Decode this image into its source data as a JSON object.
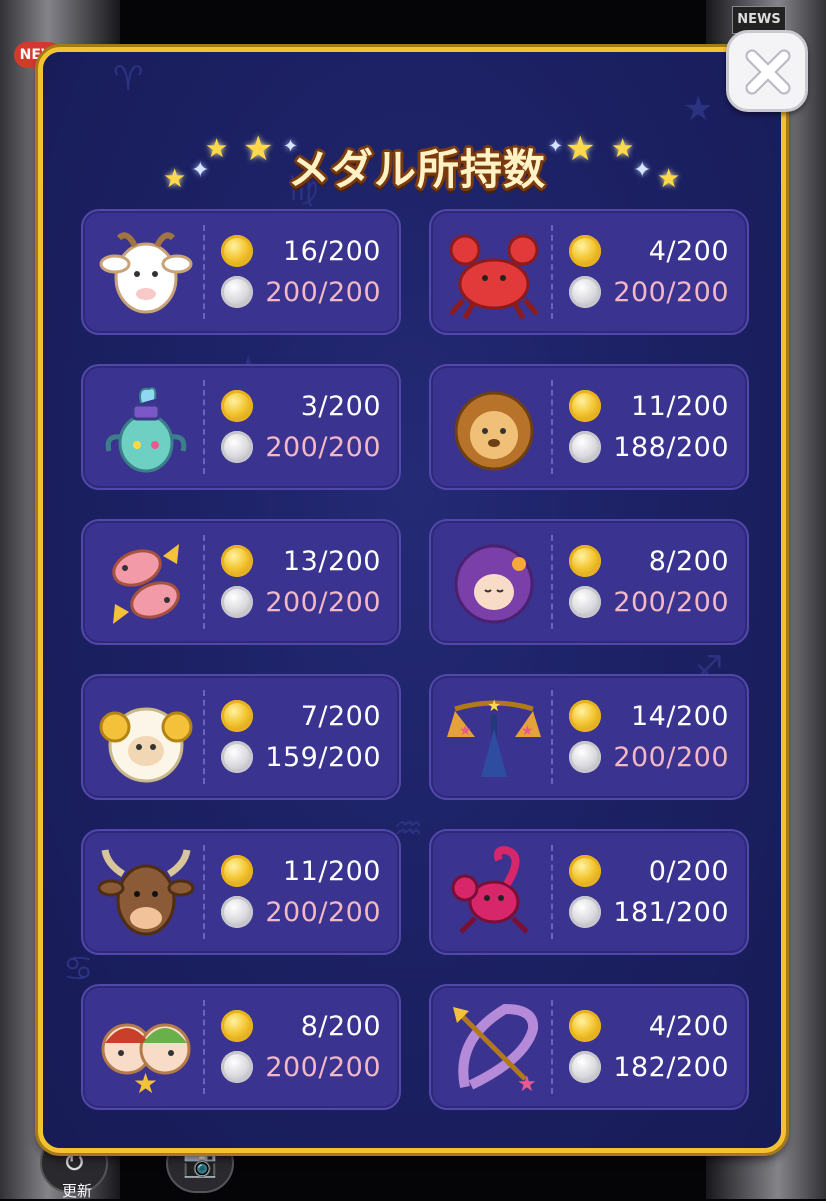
{
  "background": {
    "news_badge_left": "NEW",
    "news_badge_right": "NEWS",
    "bottom_label": "更新"
  },
  "panel": {
    "title": "メダル所持数",
    "close_icon": "close-icon",
    "colors": {
      "panel": "#1b2062",
      "border": "#f2c231",
      "card": "#3a338f",
      "full_count": "#f3b8c6"
    }
  },
  "medals": [
    {
      "sign": "aries-goat-icon",
      "gold": "16/200",
      "silver": "200/200",
      "silver_full": true
    },
    {
      "sign": "cancer-crab-icon",
      "gold": "4/200",
      "silver": "200/200",
      "silver_full": true
    },
    {
      "sign": "aquarius-vase-icon",
      "gold": "3/200",
      "silver": "200/200",
      "silver_full": true
    },
    {
      "sign": "leo-lion-icon",
      "gold": "11/200",
      "silver": "188/200",
      "silver_full": false
    },
    {
      "sign": "pisces-fish-icon",
      "gold": "13/200",
      "silver": "200/200",
      "silver_full": true
    },
    {
      "sign": "virgo-maiden-icon",
      "gold": "8/200",
      "silver": "200/200",
      "silver_full": true
    },
    {
      "sign": "aries-ram-icon",
      "gold": "7/200",
      "silver": "159/200",
      "silver_full": false
    },
    {
      "sign": "libra-scales-icon",
      "gold": "14/200",
      "silver": "200/200",
      "silver_full": true
    },
    {
      "sign": "taurus-bull-icon",
      "gold": "11/200",
      "silver": "200/200",
      "silver_full": true
    },
    {
      "sign": "scorpio-scorpion-icon",
      "gold": "0/200",
      "silver": "181/200",
      "silver_full": false
    },
    {
      "sign": "gemini-twins-icon",
      "gold": "8/200",
      "silver": "200/200",
      "silver_full": true
    },
    {
      "sign": "sagittarius-bow-icon",
      "gold": "4/200",
      "silver": "182/200",
      "silver_full": false
    }
  ]
}
